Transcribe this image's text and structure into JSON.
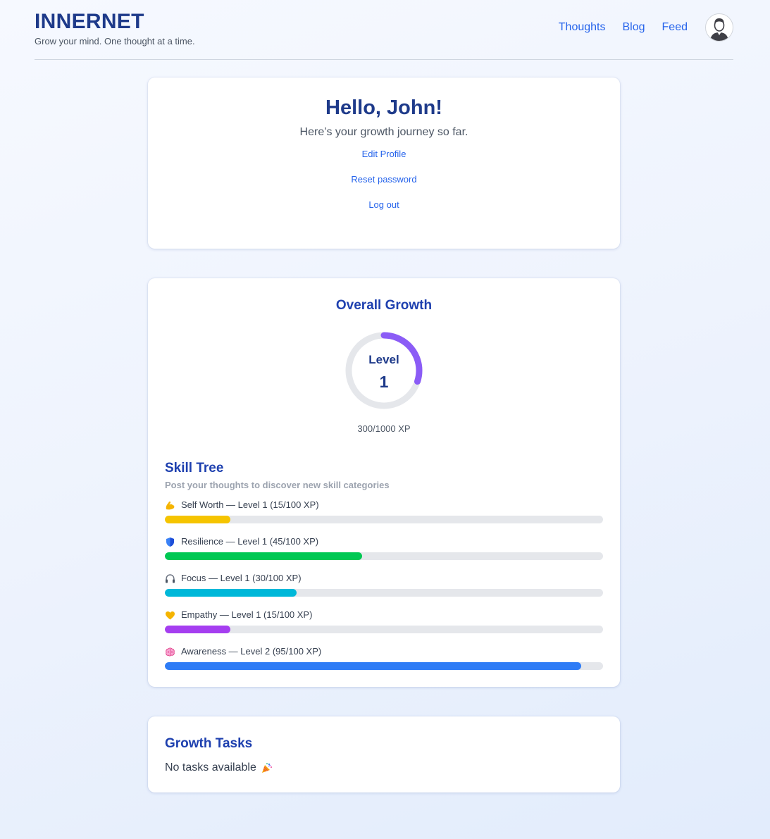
{
  "brand": {
    "title": "INNERNET",
    "tagline": "Grow your mind. One thought at a time."
  },
  "nav": {
    "items": [
      {
        "label": "Thoughts"
      },
      {
        "label": "Blog"
      },
      {
        "label": "Feed"
      }
    ],
    "avatar_icon": "user-avatar-icon"
  },
  "profile": {
    "greeting": "Hello, John!",
    "subtitle": "Here’s your growth journey so far.",
    "links": {
      "edit": "Edit Profile",
      "reset": "Reset password",
      "logout": "Log out"
    }
  },
  "growth": {
    "title": "Overall Growth",
    "level_label": "Level",
    "level": "1",
    "xp_text": "300/1000 XP",
    "xp_fraction": 0.3,
    "ring_color": "#8b5cf6",
    "ring_track_color": "#e5e7eb"
  },
  "skill_tree": {
    "title": "Skill Tree",
    "subtitle": "Post your thoughts to discover new skill categories",
    "skills": [
      {
        "icon": "flexed-biceps-icon",
        "label": "Self Worth — Level 1 (15/100 XP)",
        "progress": 0.15,
        "color": "#f5c400"
      },
      {
        "icon": "shield-icon",
        "label": "Resilience — Level 1 (45/100 XP)",
        "progress": 0.45,
        "color": "#00c853"
      },
      {
        "icon": "headphones-icon",
        "label": "Focus — Level 1 (30/100 XP)",
        "progress": 0.3,
        "color": "#00b8d9"
      },
      {
        "icon": "yellow-heart-icon",
        "label": "Empathy — Level 1 (15/100 XP)",
        "progress": 0.15,
        "color": "#a53ef0"
      },
      {
        "icon": "brain-icon",
        "label": "Awareness — Level 2 (95/100 XP)",
        "progress": 0.95,
        "color": "#2e7cf6"
      }
    ]
  },
  "tasks": {
    "title": "Growth Tasks",
    "empty_text": "No tasks available",
    "empty_icon": "party-popper-icon"
  }
}
